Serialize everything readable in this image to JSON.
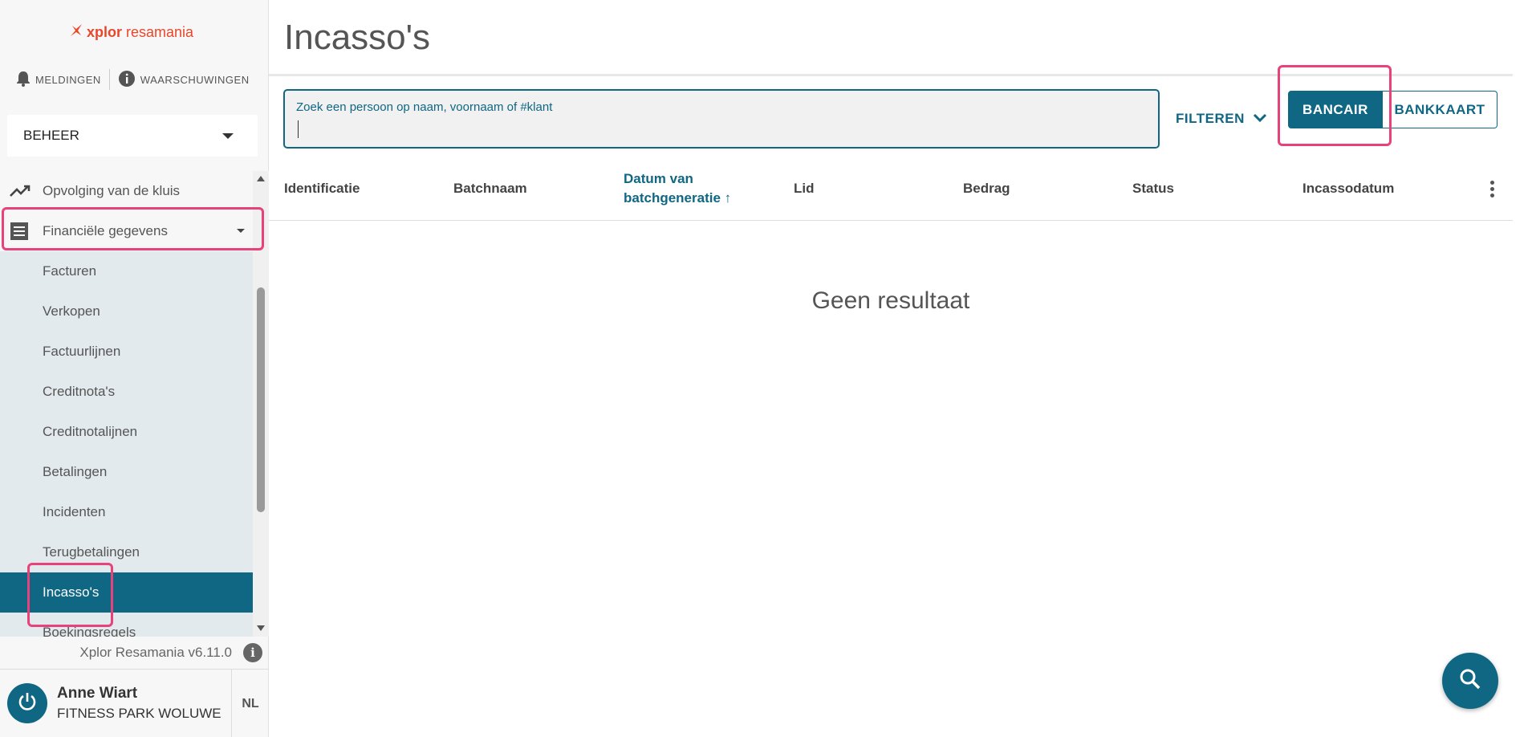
{
  "sidebar": {
    "logo": {
      "brand": "xplor",
      "product": "resamania"
    },
    "alerts": {
      "notifications": "MELDINGEN",
      "warnings": "WAARSCHUWINGEN"
    },
    "section_select": "BEHEER",
    "menu": {
      "monitoring": "Opvolging van de kluis",
      "financial": "Financiële gegevens"
    },
    "submenu": [
      "Facturen",
      "Verkopen",
      "Factuurlijnen",
      "Creditnota's",
      "Creditnotalijnen",
      "Betalingen",
      "Incidenten",
      "Terugbetalingen",
      "Incasso's",
      "Boekingsregels"
    ],
    "active_item": "Incasso's",
    "version": "Xplor Resamania v6.11.0",
    "user": {
      "name": "Anne Wiart",
      "club": "FITNESS PARK WOLUWE",
      "lang": "NL"
    }
  },
  "main": {
    "title": "Incasso's",
    "search": {
      "label": "Zoek een persoon op naam, voornaam of #klant",
      "value": ""
    },
    "filter_label": "FILTEREN",
    "toggle": {
      "active": "BANCAIR",
      "inactive": "BANKKAART"
    },
    "table": {
      "columns": {
        "id": "Identificatie",
        "batch": "Batchnaam",
        "date_line1": "Datum van",
        "date_line2": "batchgeneratie ↑",
        "member": "Lid",
        "amount": "Bedrag",
        "status": "Status",
        "collection_date": "Incassodatum"
      }
    },
    "empty_message": "Geen resultaat"
  },
  "colors": {
    "primary": "#0f6784",
    "brand": "#e8472b",
    "highlight": "#e8427a",
    "submenu_bg": "#e3eaed"
  },
  "icons": [
    "bell-icon",
    "info-icon",
    "chevron-down-icon",
    "trending-up-icon",
    "receipt-icon",
    "power-icon",
    "search-icon",
    "kebab-icon"
  ]
}
